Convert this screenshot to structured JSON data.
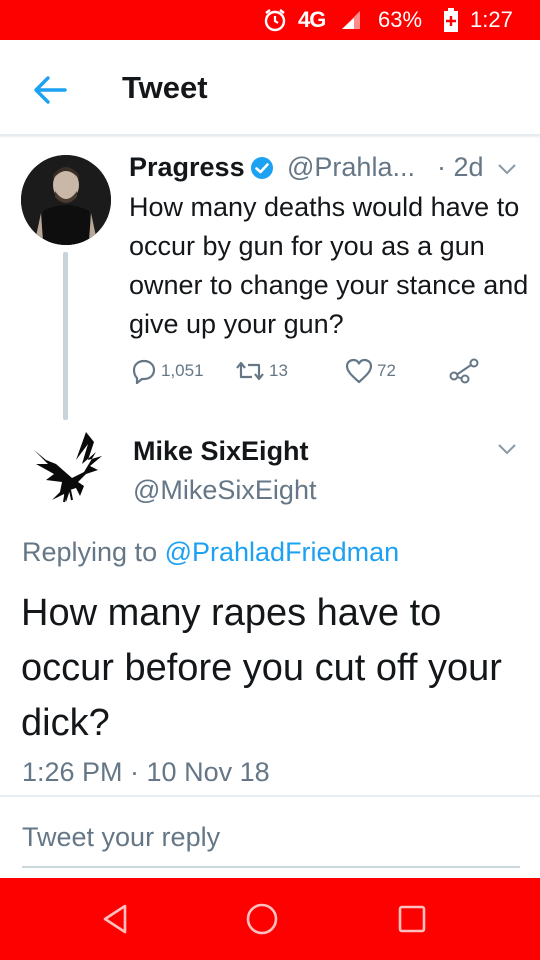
{
  "status_bar": {
    "network": "4G",
    "battery_percent": "63%",
    "time": "1:27",
    "bar_color": "#fd0000",
    "icons": [
      "alarm-icon",
      "network-icon",
      "signal-icon",
      "battery-icon"
    ]
  },
  "app_bar": {
    "title": "Tweet",
    "back_icon": "arrow-left-icon",
    "accent_color": "#1da1f2"
  },
  "parent_tweet": {
    "display_name": "Pragress",
    "verified": true,
    "handle": "@Prahla...",
    "time": "· 2d",
    "text": "How many deaths would have to occur by gun for you as a gun owner to change your stance and give up your gun?",
    "reply_count": "1,051",
    "retweet_count": "13",
    "like_count": "72"
  },
  "main_tweet": {
    "display_name": "Mike SixEight",
    "handle": "@MikeSixEight",
    "replying_prefix": "Replying to ",
    "replying_to": "@PrahladFriedman",
    "text": "How many rapes have to occur before you cut off your dick?",
    "timestamp": "1:26 PM · 10 Nov 18"
  },
  "reply_composer": {
    "placeholder": "Tweet your reply"
  },
  "nav_bar": {
    "buttons": [
      "back-triangle-icon",
      "home-circle-icon",
      "recents-square-icon"
    ]
  }
}
